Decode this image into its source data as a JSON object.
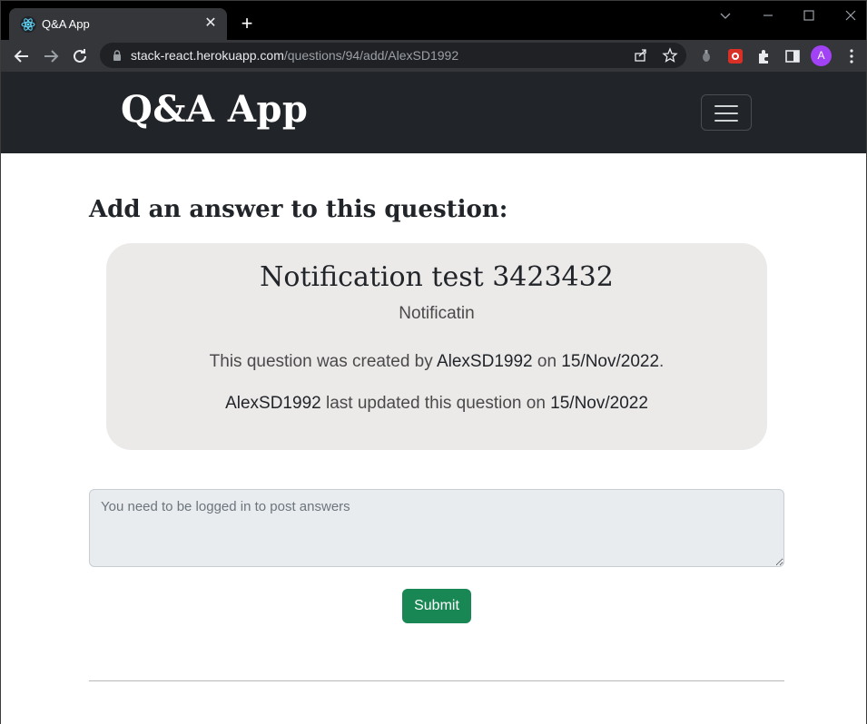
{
  "browser": {
    "tab_title": "Q&A App",
    "url_host": "stack-react.herokuapp.com",
    "url_path": "/questions/94/add/AlexSD1992",
    "profile_initial": "A",
    "avatar_color": "#a142f4"
  },
  "navbar": {
    "brand": "Q&A App",
    "background": "#212529"
  },
  "page": {
    "heading": "Add an answer to this question:"
  },
  "question": {
    "title": "Notification test 3423432",
    "body": "Notificatin",
    "created_prefix": "This question was created by",
    "author": "AlexSD1992",
    "created_on_word": "on",
    "created_date": "15/Nov/2022",
    "created_suffix": ".",
    "updated_author": "AlexSD1992",
    "updated_text": "last updated this question on",
    "updated_date": "15/Nov/2022"
  },
  "answer_form": {
    "placeholder": "You need to be logged in to post answers",
    "submit_label": "Submit",
    "submit_color": "#198754"
  }
}
